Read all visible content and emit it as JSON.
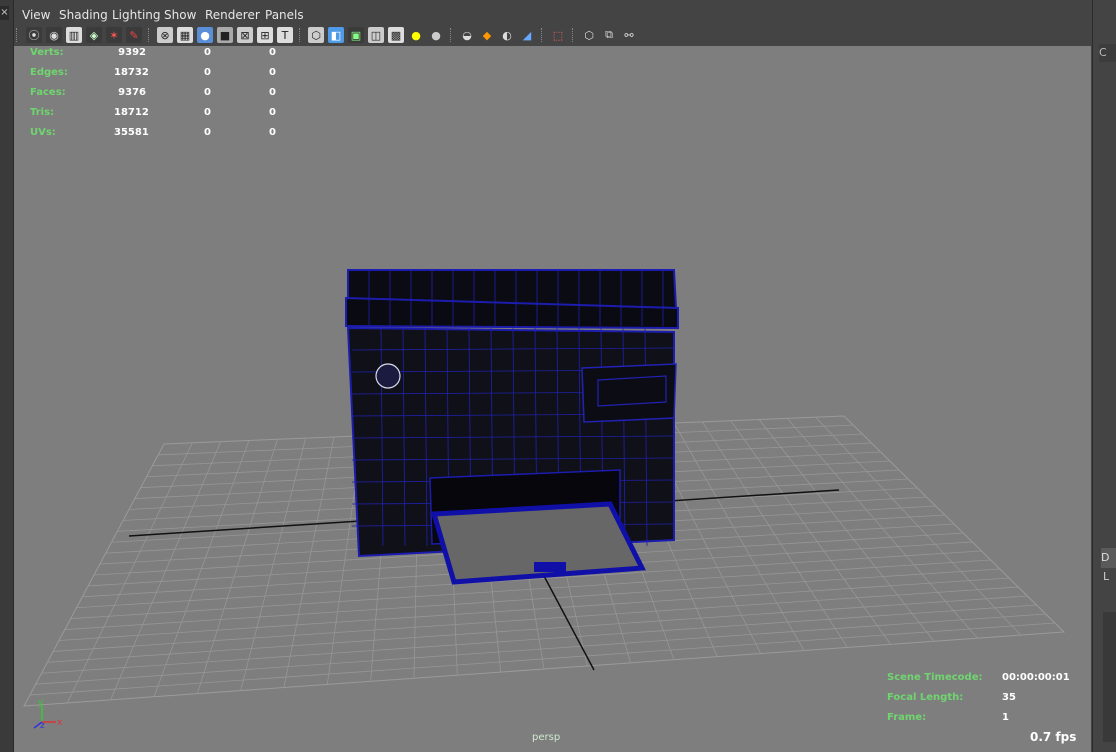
{
  "menu": [
    "View",
    "Shading",
    "Lighting",
    "Show",
    "Renderer",
    "Panels"
  ],
  "toolbar_icons": [
    "select-camera-icon",
    "camera-attributes-icon",
    "bookmark-icon",
    "image-plane-icon",
    "grid-icon",
    "film-gate-icon",
    "resolution-gate-icon",
    "field-chart-icon",
    "safe-action-icon",
    "safe-title-icon",
    "wireframe-icon",
    "smooth-shade-icon",
    "flat-shade-icon",
    "bounding-box-icon",
    "points-icon",
    "text-icon",
    "default-material-icon",
    "xray-icon",
    "xray-joints-icon",
    "xray-components-icon",
    "textured-icon",
    "use-default-light-icon",
    "all-lights-icon",
    "shadows-icon",
    "screen-space-ao-icon",
    "motion-blur-icon",
    "anti-alias-icon",
    "depth-of-field-icon",
    "isolate-select-icon",
    "isolate-view-icon",
    "viewport-renderer-icon"
  ],
  "hud_stats": {
    "rows": [
      {
        "label": "Verts:",
        "v1": "9392",
        "v2": "0",
        "v3": "0"
      },
      {
        "label": "Edges:",
        "v1": "18732",
        "v2": "0",
        "v3": "0"
      },
      {
        "label": "Faces:",
        "v1": "9376",
        "v2": "0",
        "v3": "0"
      },
      {
        "label": "Tris:",
        "v1": "18712",
        "v2": "0",
        "v3": "0"
      },
      {
        "label": "UVs:",
        "v1": "35581",
        "v2": "0",
        "v3": "0"
      }
    ]
  },
  "hud_info": {
    "scene_timecode_label": "Scene Timecode:",
    "scene_timecode_value": "00:00:00:01",
    "focal_length_label": "Focal Length:",
    "focal_length_value": "35",
    "frame_label": "Frame:",
    "frame_value": "1"
  },
  "camera_name": "persp",
  "fps": "0.7 fps",
  "axis": {
    "y": "y",
    "x": "x",
    "z": "z"
  },
  "colors": {
    "viewport_bg": "#7e7e7e",
    "wireframe": "#1a1a9c",
    "hud_label": "#6fd66f",
    "hud_value": "#ffffff"
  },
  "right_panel": {
    "top_char": "C",
    "mid_char": "D",
    "mid2_char": "L"
  }
}
